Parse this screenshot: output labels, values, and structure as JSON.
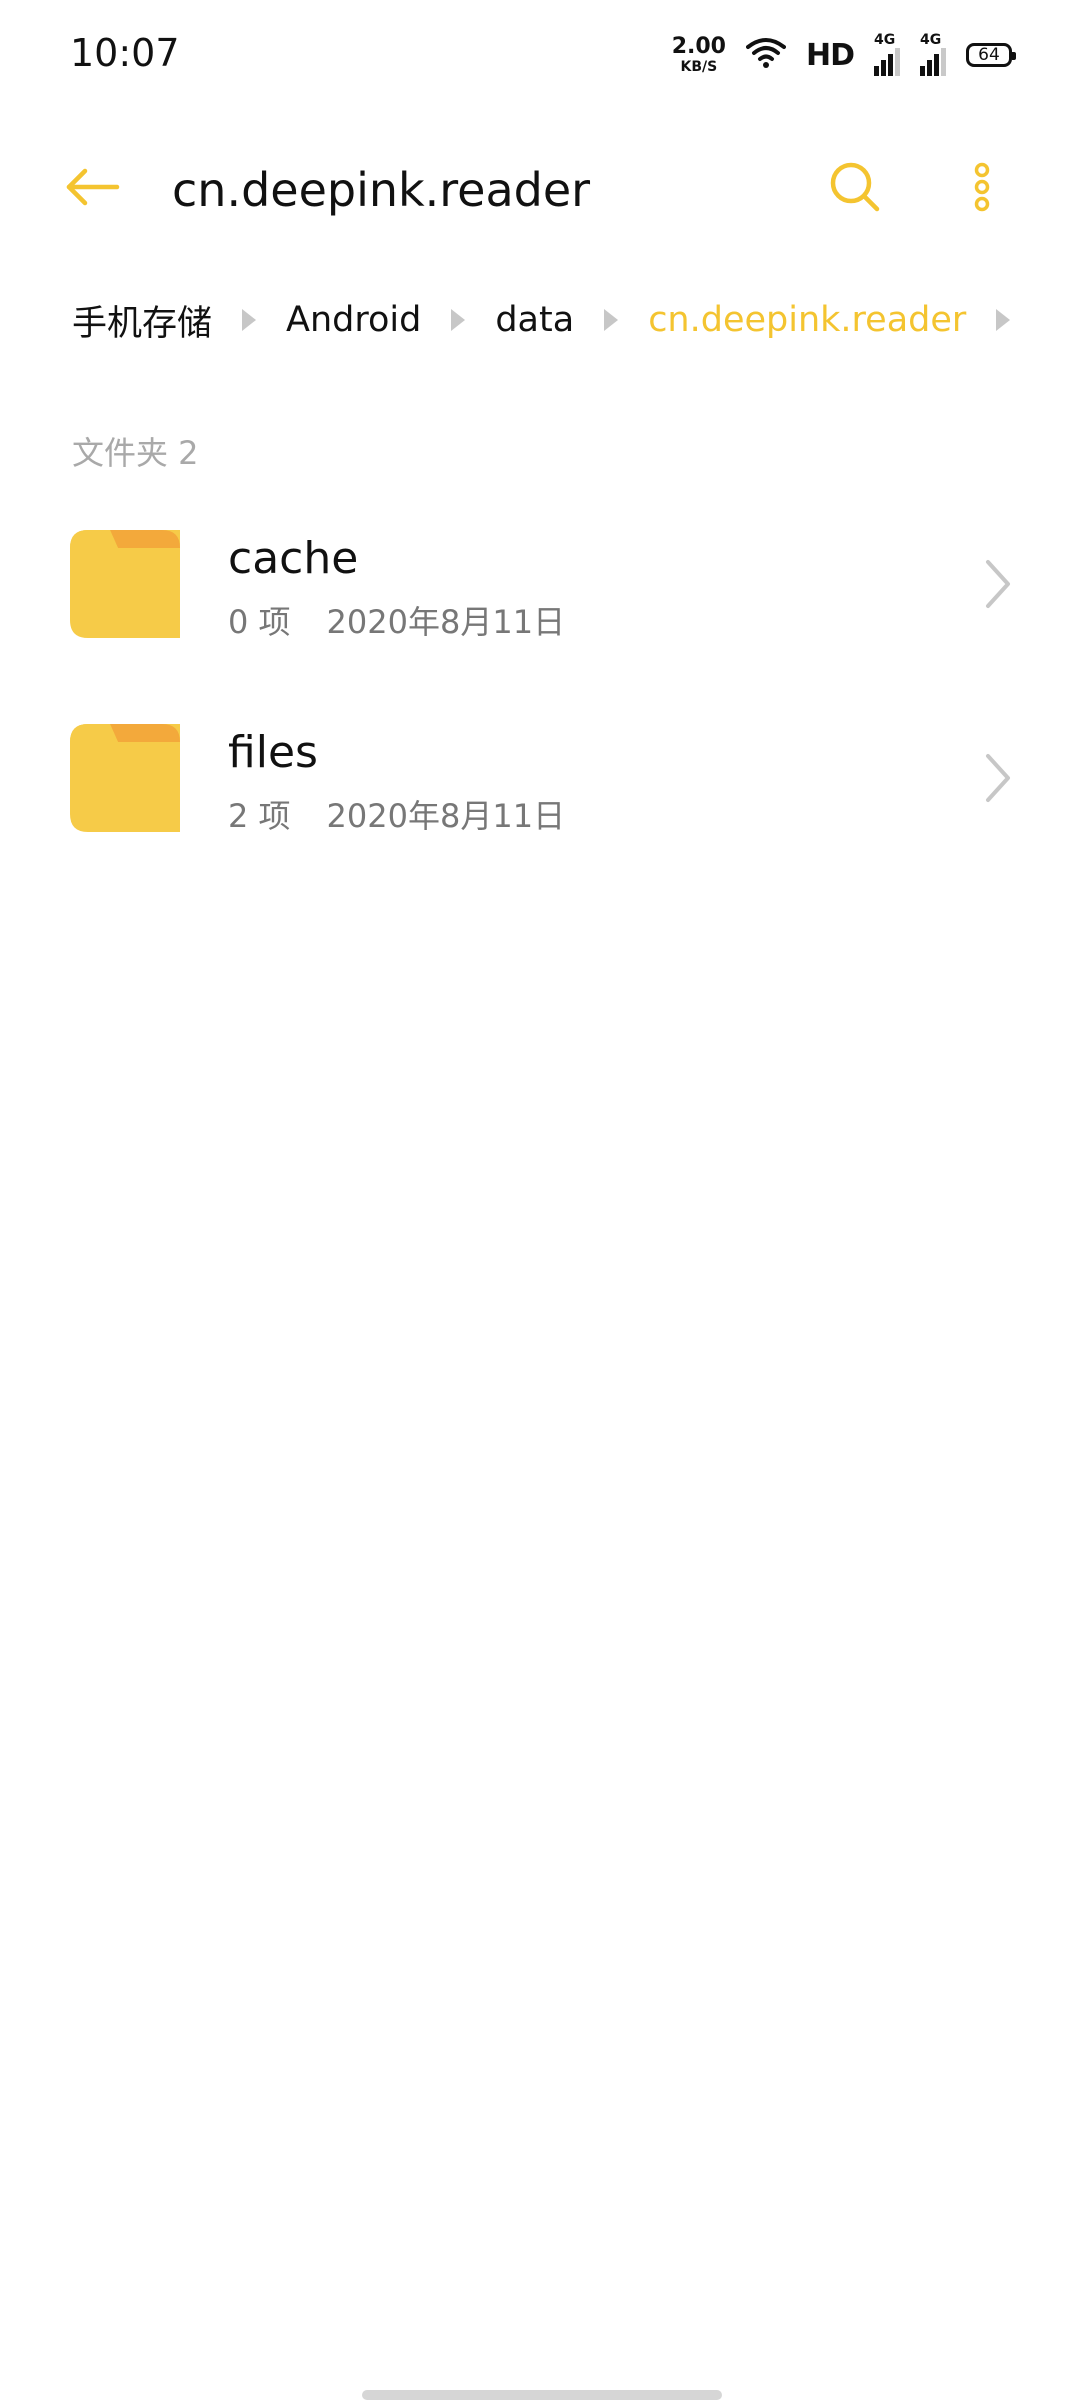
{
  "status_bar": {
    "time": "10:07",
    "net_speed_value": "2.00",
    "net_speed_unit": "KB/S",
    "hd_label": "HD",
    "signal1_label": "4G",
    "signal2_label": "4G",
    "battery_level": "64"
  },
  "app_bar": {
    "title": "cn.deepink.reader",
    "back_icon": "arrow-left-icon",
    "search_icon": "search-icon",
    "more_icon": "more-vertical-icon"
  },
  "breadcrumb": {
    "items": [
      {
        "label": "手机存储"
      },
      {
        "label": "Android"
      },
      {
        "label": "data"
      },
      {
        "label": "cn.deepink.reader"
      }
    ]
  },
  "section": {
    "header": "文件夹 2"
  },
  "folders": [
    {
      "name": "cache",
      "count": "0 项",
      "date": "2020年8月11日"
    },
    {
      "name": "files",
      "count": "2 项",
      "date": "2020年8月11日"
    }
  ],
  "colors": {
    "accent": "#f4c430",
    "folder_body": "#f6cb48",
    "folder_tab": "#f3a93b",
    "secondary_text": "#777777",
    "section_text": "#a9a9a9"
  }
}
